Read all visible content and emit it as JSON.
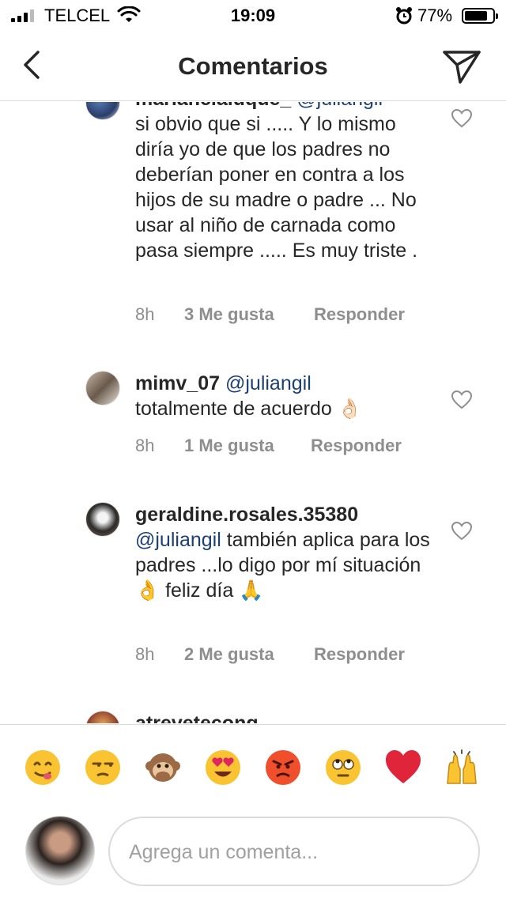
{
  "status_bar": {
    "carrier": "TELCEL",
    "time": "19:09",
    "battery": "77%",
    "battery_level": 0.77
  },
  "header": {
    "title": "Comentarios",
    "back_icon": "chevron-left-icon",
    "share_icon": "paper-plane-icon"
  },
  "comments": [
    {
      "username": "mariancialuque_",
      "mention": "@juliangil",
      "text": "si obvio que si ..... Y lo mismo diría yo de que los padres no deberían poner en contra a los hijos de su madre o padre ... No usar al niño de carnada como pasa siempre ..... Es muy triste .",
      "time": "8h",
      "likes": "3 Me gusta",
      "reply": "Responder"
    },
    {
      "username": "mimv_07",
      "mention": "@juliangil",
      "text": "totalmente de acuerdo 👌🏻",
      "time": "8h",
      "likes": "1 Me gusta",
      "reply": "Responder"
    },
    {
      "username": "geraldine.rosales.35380",
      "mention": "@juliangil",
      "text": "también aplica para los padres ...lo digo por mí  situación 👌 feliz día 🙏",
      "time": "8h",
      "likes": "2 Me gusta",
      "reply": "Responder"
    },
    {
      "username": "atrevetecong"
    }
  ],
  "emoji_bar": [
    "😋",
    "😒",
    "🙊",
    "😍",
    "😡",
    "🙄",
    "❤️",
    "🙌"
  ],
  "composer": {
    "placeholder": "Agrega un comenta..."
  },
  "colors": {
    "mention": "#1e3f73",
    "meta": "#8e8e8e",
    "divider": "#dbdbdb"
  }
}
